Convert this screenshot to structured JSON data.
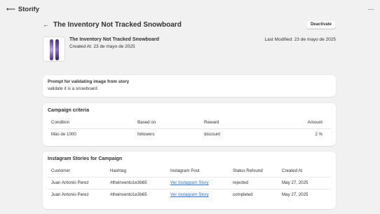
{
  "app": {
    "title": "Storify",
    "back_icon": "⟵",
    "more_icon": "⋯"
  },
  "page": {
    "back_icon": "←",
    "title": "The Inventory Not Tracked Snowboard",
    "deactivate_label": "Deactivate"
  },
  "product": {
    "name": "The Inventory Not Tracked Snowboard",
    "created": "Created At: 23 de mayo de 2025",
    "last_modified": "Last Modified: 23 de mayo de 2025"
  },
  "prompt": {
    "heading": "Prompt for validating image from story",
    "value": "validate it is a snowboard"
  },
  "campaign": {
    "title": "Campaign criteria",
    "headers": [
      "Condition",
      "Based on",
      "Reward",
      "Amount"
    ],
    "rows": [
      [
        "Más de 1000",
        "followers",
        "discount",
        "2 %"
      ]
    ]
  },
  "stories": {
    "title": "Instagram Stories for Campaign",
    "headers": [
      "Customer",
      "Hashtag",
      "Instagram Post",
      "Status Refound",
      "Created At"
    ],
    "rows": [
      [
        "Juan Antonio Perez",
        "#theinvento1e3b65",
        "Ver Instagram Story",
        "rejected",
        "May 27, 2025"
      ],
      [
        "Juan Antonio Perez",
        "#theinvento1e3b65",
        "Ver Instagram Story",
        "completed",
        "May 27, 2025"
      ]
    ]
  },
  "colors": {
    "link": "#2c6ecb",
    "background": "#f1f1f1",
    "card": "#ffffff"
  }
}
